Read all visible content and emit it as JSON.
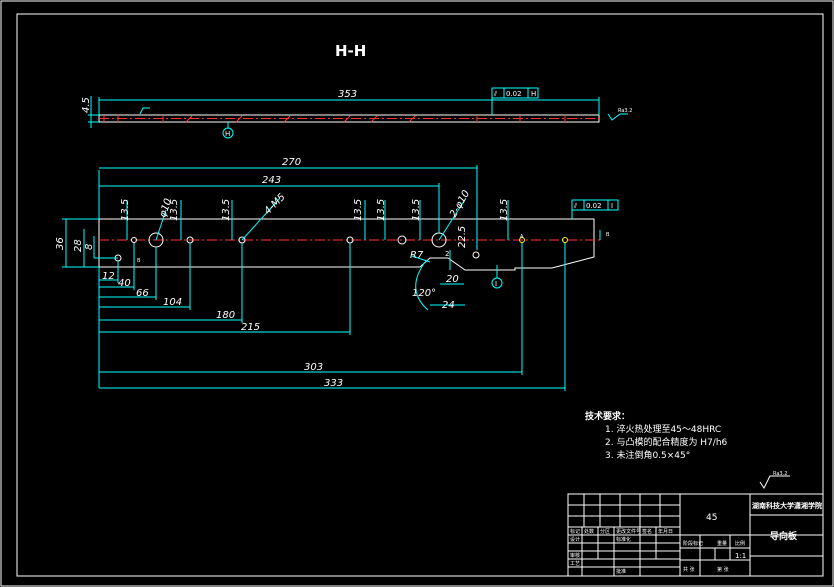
{
  "section_title": "H-H",
  "section_dims": {
    "thickness": "4.5",
    "length": "353",
    "flatness": "0.02",
    "datum": "H",
    "roughness": "Ra3.2"
  },
  "main_dims": {
    "overall_270": "270",
    "overall_243": "243",
    "dia10_left": "φ10",
    "dia10_right": "2-φ10",
    "thread": "4-M5",
    "v13_5": [
      "13.5",
      "13.5",
      "13.5",
      "13.5",
      "13.5",
      "13.5",
      "13.5"
    ],
    "h36": "36",
    "h28": "28",
    "h8": "8",
    "b12": "12",
    "b40": "40",
    "b66": "66",
    "b104": "104",
    "b180": "180",
    "b215": "215",
    "b303": "303",
    "b333": "333",
    "r7": "R7",
    "d22_5": "22.5",
    "d20": "20",
    "d24": "24",
    "angle": "120°",
    "flatness2": "0.02",
    "datum2": "I",
    "small_B": "B",
    "small_A": "A",
    "small_2": "2"
  },
  "tech_req": {
    "heading": "技术要求：",
    "items": [
      "1.  淬火热处理至45～48HRC",
      "2.  与凸模的配合精度为 H7/h6",
      "3.  未注倒角0.5×45°"
    ]
  },
  "corner_roughness": "Ra3.2",
  "title_block": {
    "material": "45",
    "school": "湖南科技大学潇湘学院",
    "part_name": "导向板",
    "scale": "1:1",
    "cells": [
      "标记",
      "处数",
      "分区",
      "更改文件号",
      "签名",
      "年月日",
      "设计",
      "标准化",
      "审核",
      "工艺",
      "批准",
      "阶段标记",
      "重量",
      "比例",
      "共 张",
      "第 张"
    ]
  }
}
